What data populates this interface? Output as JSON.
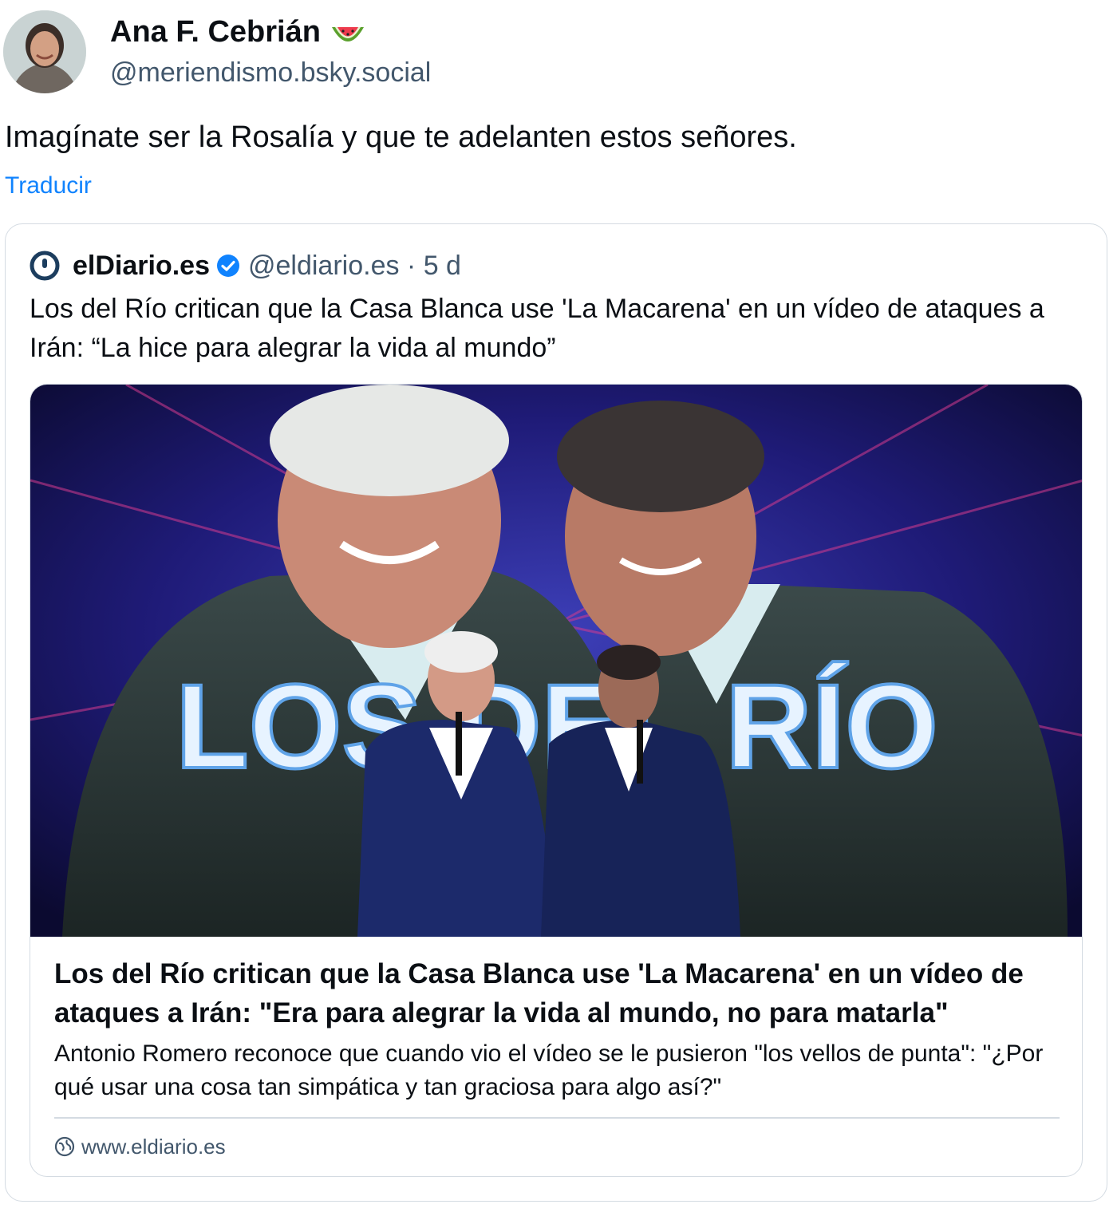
{
  "author": {
    "display_name": "Ana F. Cebrián",
    "emoji": "watermelon-icon",
    "handle": "@meriendismo.bsky.social"
  },
  "post": {
    "text": "Imagínate ser la Rosalía y que te adelanten estos señores.",
    "translate_label": "Traducir"
  },
  "quote": {
    "name": "elDiario.es",
    "handle_time": "@eldiario.es · 5 d",
    "text": "Los del Río critican que la Casa Blanca use 'La Macarena' en un vídeo de ataques a Irán: “La hice para alegrar la vida al mundo”",
    "link_card": {
      "image_text": "LOS DEL RÍO",
      "title": "Los del Río critican que la Casa Blanca use 'La Macarena' en un vídeo de ataques a Irán: \"Era para alegrar la vida al mundo, no para matarla\"",
      "description": "Antonio Romero reconoce que cuando vio el vídeo se le pusieron \"los vellos de punta\": \"¿Por qué usar una cosa tan simpática y tan graciosa para algo así?\"",
      "domain": "www.eldiario.es"
    }
  },
  "colors": {
    "link": "#1083fe",
    "muted": "#42576c",
    "border": "#d4dbe2",
    "verified": "#1083fe"
  }
}
